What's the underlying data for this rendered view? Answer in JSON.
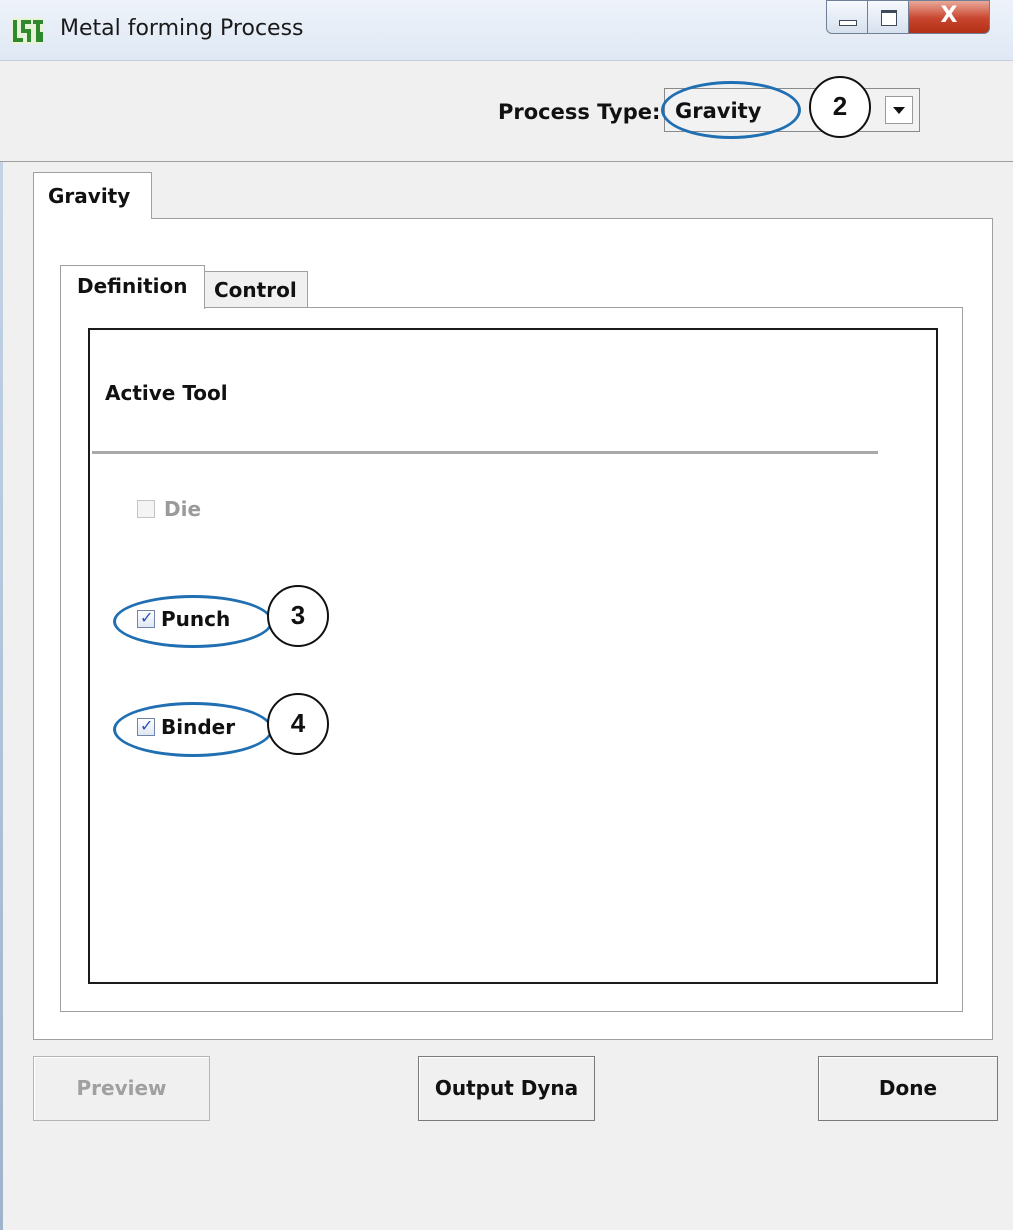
{
  "window": {
    "title": "Metal forming Process",
    "logo_icon": "lstc-logo-icon",
    "controls": {
      "minimize_icon": "minimize-icon",
      "maximize_icon": "maximize-icon",
      "close_glyph": "X"
    }
  },
  "header": {
    "process_type_label": "Process Type:",
    "process_type_value": "Gravity"
  },
  "tabs": {
    "outer": [
      "Gravity"
    ],
    "inner": [
      "Definition",
      "Control"
    ],
    "active_inner": "Definition"
  },
  "definition": {
    "section_title": "Active Tool",
    "tools": [
      {
        "label": "Die",
        "checked": false,
        "enabled": false
      },
      {
        "label": "Punch",
        "checked": true,
        "enabled": true
      },
      {
        "label": "Binder",
        "checked": true,
        "enabled": true
      }
    ]
  },
  "annotations": {
    "callouts": [
      "2",
      "3",
      "4"
    ],
    "highlight_color": "#1f6fb2"
  },
  "buttons": {
    "preview": "Preview",
    "output": "Output Dyna",
    "done": "Done"
  }
}
